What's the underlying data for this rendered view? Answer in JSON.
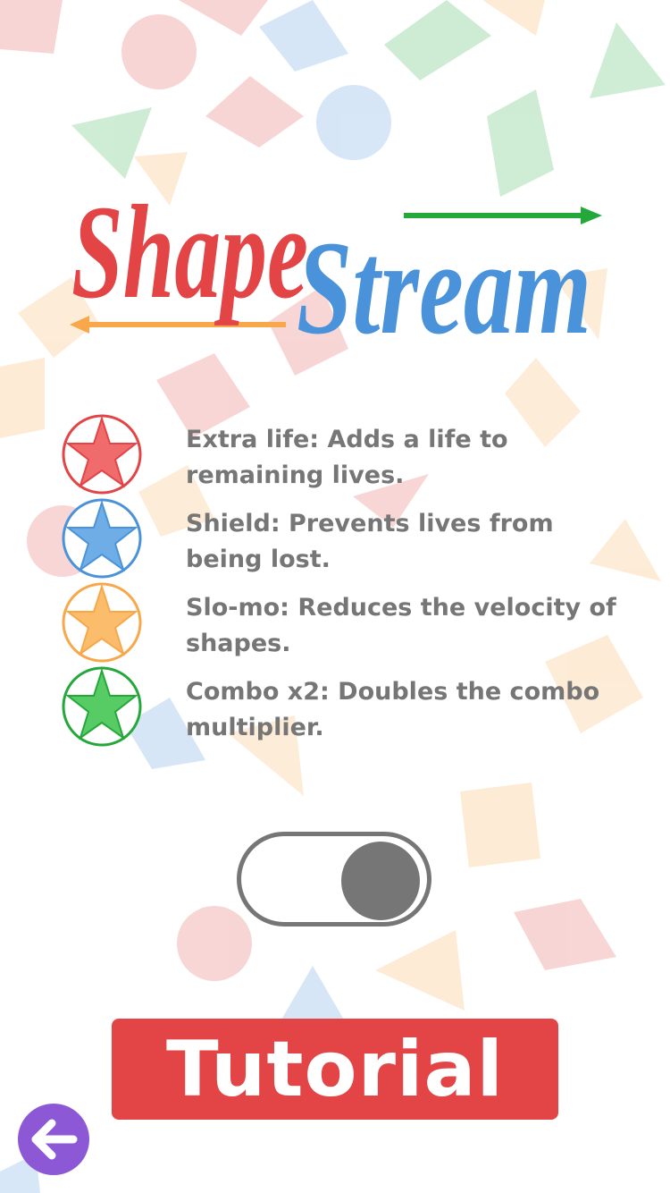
{
  "logo": {
    "word1": "Shape",
    "word2": "Stream"
  },
  "powerups": [
    {
      "label": "Extra life: Adds a life to remaining lives.",
      "icon": "red-star-icon",
      "color": "#e34446"
    },
    {
      "label": "Shield: Prevents lives from being lost.",
      "icon": "blue-star-icon",
      "color": "#4a93da"
    },
    {
      "label": "Slo-mo: Reduces the velocity of shapes.",
      "icon": "orange-star-icon",
      "color": "#f8a84a"
    },
    {
      "label": "Combo x2: Doubles the combo multiplier.",
      "icon": "green-star-icon",
      "color": "#24a83a"
    }
  ],
  "toggle": {
    "state": "on"
  },
  "tutorial_button": {
    "label": "Tutorial"
  },
  "back_button": {
    "icon": "back-arrow-icon"
  },
  "colors": {
    "red": "#e34446",
    "blue": "#4a93da",
    "orange": "#f8a84a",
    "green": "#24a83a",
    "text_gray": "#767676",
    "purple": "#8d58d6"
  }
}
